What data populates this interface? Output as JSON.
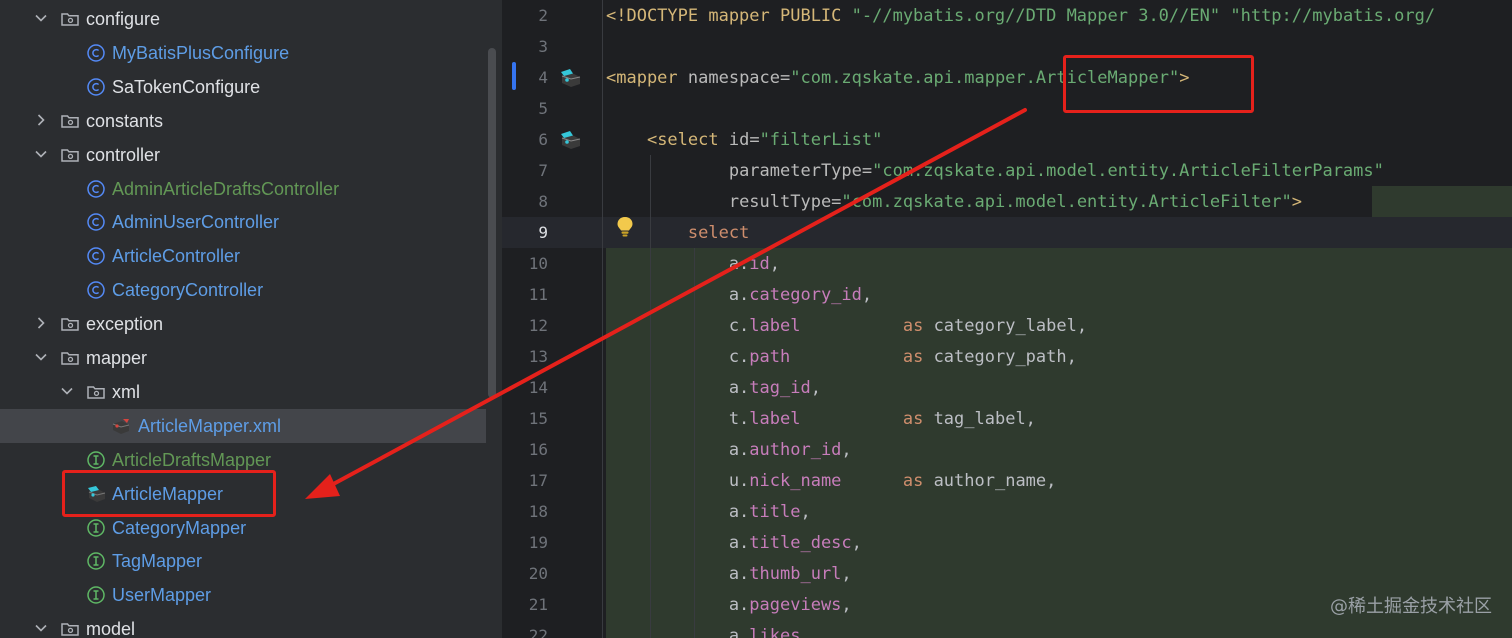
{
  "project_tree": {
    "items": [
      {
        "label": "configure",
        "kind": "folder",
        "expanded": true,
        "depth": 1
      },
      {
        "label": "MyBatisPlusConfigure",
        "kind": "class",
        "color": "blue",
        "depth": 2
      },
      {
        "label": "SaTokenConfigure",
        "kind": "class",
        "color": "white",
        "depth": 2
      },
      {
        "label": "constants",
        "kind": "folder",
        "expanded": false,
        "depth": 1
      },
      {
        "label": "controller",
        "kind": "folder",
        "expanded": true,
        "depth": 1
      },
      {
        "label": "AdminArticleDraftsController",
        "kind": "class",
        "color": "green",
        "depth": 2
      },
      {
        "label": "AdminUserController",
        "kind": "class",
        "color": "blue",
        "depth": 2
      },
      {
        "label": "ArticleController",
        "kind": "class",
        "color": "blue",
        "depth": 2
      },
      {
        "label": "CategoryController",
        "kind": "class",
        "color": "blue",
        "depth": 2
      },
      {
        "label": "exception",
        "kind": "folder",
        "expanded": false,
        "depth": 1
      },
      {
        "label": "mapper",
        "kind": "folder",
        "expanded": true,
        "depth": 1
      },
      {
        "label": "xml",
        "kind": "folder",
        "expanded": true,
        "depth": 2
      },
      {
        "label": "ArticleMapper.xml",
        "kind": "mybatis-xml",
        "color": "blue",
        "depth": 3,
        "selected": true
      },
      {
        "label": "ArticleDraftsMapper",
        "kind": "interface",
        "color": "green",
        "depth": 2
      },
      {
        "label": "ArticleMapper",
        "kind": "mybatis-interface",
        "color": "blue",
        "depth": 2,
        "highlighted": true
      },
      {
        "label": "CategoryMapper",
        "kind": "interface",
        "color": "blue",
        "depth": 2
      },
      {
        "label": "TagMapper",
        "kind": "interface",
        "color": "blue",
        "depth": 2
      },
      {
        "label": "UserMapper",
        "kind": "interface",
        "color": "blue",
        "depth": 2
      },
      {
        "label": "model",
        "kind": "folder",
        "expanded": true,
        "depth": 1
      }
    ]
  },
  "editor": {
    "current_line": 9,
    "lines": [
      {
        "n": "2",
        "tokens": [
          [
            "tag",
            "<!DOCTYPE mapper PUBLIC "
          ],
          [
            "str",
            "\"-//mybatis.org//DTD Mapper 3.0//EN\""
          ],
          [
            "plain",
            " "
          ],
          [
            "str",
            "\"http://mybatis.org/"
          ]
        ]
      },
      {
        "n": "3",
        "tokens": []
      },
      {
        "n": "4",
        "gutter_icon": true,
        "tokens": [
          [
            "tag",
            "<mapper "
          ],
          [
            "attr",
            "namespace="
          ],
          [
            "str",
            "\"com.zqskate.api.mapper.ArticleMapper\""
          ],
          [
            "tag",
            ">"
          ]
        ]
      },
      {
        "n": "5",
        "tokens": []
      },
      {
        "n": "6",
        "gutter_icon": true,
        "tokens": [
          [
            "plain",
            "    "
          ],
          [
            "tag",
            "<select "
          ],
          [
            "attr",
            "id="
          ],
          [
            "str",
            "\"filterList\""
          ]
        ]
      },
      {
        "n": "7",
        "tokens": [
          [
            "plain",
            "            "
          ],
          [
            "attr",
            "parameterType="
          ],
          [
            "str",
            "\"com.zqskate.api.model.entity.ArticleFilterParams\""
          ]
        ]
      },
      {
        "n": "8",
        "tokens": [
          [
            "plain",
            "            "
          ],
          [
            "attr",
            "resultType="
          ],
          [
            "str",
            "\"com.zqskate.api.model.entity.ArticleFilter\""
          ],
          [
            "tag",
            ">"
          ]
        ]
      },
      {
        "n": "9",
        "tokens": [
          [
            "plain",
            "        "
          ],
          [
            "kw",
            "select"
          ]
        ]
      },
      {
        "n": "10",
        "tokens": [
          [
            "plain",
            "            a."
          ],
          [
            "field",
            "id"
          ],
          [
            "plain",
            ","
          ]
        ]
      },
      {
        "n": "11",
        "tokens": [
          [
            "plain",
            "            a."
          ],
          [
            "field",
            "category_id"
          ],
          [
            "plain",
            ","
          ]
        ]
      },
      {
        "n": "12",
        "tokens": [
          [
            "plain",
            "            c."
          ],
          [
            "field",
            "label"
          ],
          [
            "plain",
            "          "
          ],
          [
            "kw",
            "as"
          ],
          [
            "plain",
            " category_label,"
          ]
        ]
      },
      {
        "n": "13",
        "tokens": [
          [
            "plain",
            "            c."
          ],
          [
            "field",
            "path"
          ],
          [
            "plain",
            "           "
          ],
          [
            "kw",
            "as"
          ],
          [
            "plain",
            " category_path,"
          ]
        ]
      },
      {
        "n": "14",
        "tokens": [
          [
            "plain",
            "            a."
          ],
          [
            "field",
            "tag_id"
          ],
          [
            "plain",
            ","
          ]
        ]
      },
      {
        "n": "15",
        "tokens": [
          [
            "plain",
            "            t."
          ],
          [
            "field",
            "label"
          ],
          [
            "plain",
            "          "
          ],
          [
            "kw",
            "as"
          ],
          [
            "plain",
            " tag_label,"
          ]
        ]
      },
      {
        "n": "16",
        "tokens": [
          [
            "plain",
            "            a."
          ],
          [
            "field",
            "author_id"
          ],
          [
            "plain",
            ","
          ]
        ]
      },
      {
        "n": "17",
        "tokens": [
          [
            "plain",
            "            u."
          ],
          [
            "field",
            "nick_name"
          ],
          [
            "plain",
            "      "
          ],
          [
            "kw",
            "as"
          ],
          [
            "plain",
            " author_name,"
          ]
        ]
      },
      {
        "n": "18",
        "tokens": [
          [
            "plain",
            "            a."
          ],
          [
            "field",
            "title"
          ],
          [
            "plain",
            ","
          ]
        ]
      },
      {
        "n": "19",
        "tokens": [
          [
            "plain",
            "            a."
          ],
          [
            "field",
            "title_desc"
          ],
          [
            "plain",
            ","
          ]
        ]
      },
      {
        "n": "20",
        "tokens": [
          [
            "plain",
            "            a."
          ],
          [
            "field",
            "thumb_url"
          ],
          [
            "plain",
            ","
          ]
        ]
      },
      {
        "n": "21",
        "tokens": [
          [
            "plain",
            "            a."
          ],
          [
            "field",
            "pageviews"
          ],
          [
            "plain",
            ","
          ]
        ]
      },
      {
        "n": "22",
        "tokens": [
          [
            "plain",
            "            a."
          ],
          [
            "field",
            "likes"
          ]
        ]
      }
    ]
  },
  "colors": {
    "annotation_red": "#e5211b",
    "tree_blue": "#5e9de6",
    "tree_green": "#629755",
    "string_green": "#6aab73",
    "keyword_orange": "#cf8e6d"
  },
  "watermark": "@稀土掘金技术社区"
}
